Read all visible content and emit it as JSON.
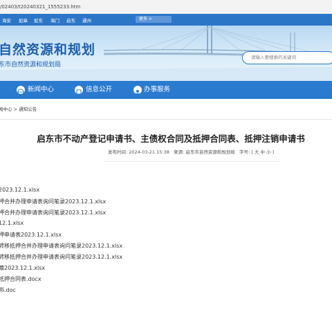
{
  "browser": {
    "url_fragment": "/02403/t20240321_1555233.htm"
  },
  "topnav": {
    "cities": [
      "海安",
      "如皋",
      "如东",
      "海门",
      "启东",
      "通州"
    ],
    "more_label": "更多 >"
  },
  "header": {
    "title": "自然资源和规划",
    "subtitle": "东市自然资源和规划局",
    "search_placeholder": "请输入要搜索的关键词"
  },
  "mainnav": {
    "items": [
      {
        "label": "新闻中心",
        "icon": "globe-icon"
      },
      {
        "label": "信息公开",
        "icon": "info-icon"
      },
      {
        "label": "办事服务",
        "icon": "service-icon"
      }
    ]
  },
  "breadcrumb": {
    "text": "闻中心 > 通知公告"
  },
  "article": {
    "title": "启东市不动产登记申请书、主债权合同及抵押合同表、抵押注销申请书",
    "meta": {
      "published_label": "发布时间:",
      "published_value": "2024-03-21 15:38",
      "source_label": "来源:",
      "source_value": "启东市自然资源和规划局",
      "font_label": "字号:",
      "font_sizes": "[ 大 中 小 ]"
    },
    "attachments": [
      "2023.12.1.xlsx",
      "押合并办理申请表询问笔录2023.12.1.xlsx",
      "押合并办理申请表询问笔录2023.12.1.xlsx",
      "12.1.xlsx",
      "押申请表2023.12.1.xlsx",
      "转移抵押合并办理申请表询问笔录2023.12.1.xlsx",
      "转移抵押合并办理申请表询问笔录2023.12.1.xlsx",
      "籍2023.12.1.xlsx",
      "抵押合同表.docx",
      "书.doc"
    ]
  },
  "colors": {
    "brand_blue": "#2a7ad0",
    "title_blue": "#1e5fae"
  }
}
